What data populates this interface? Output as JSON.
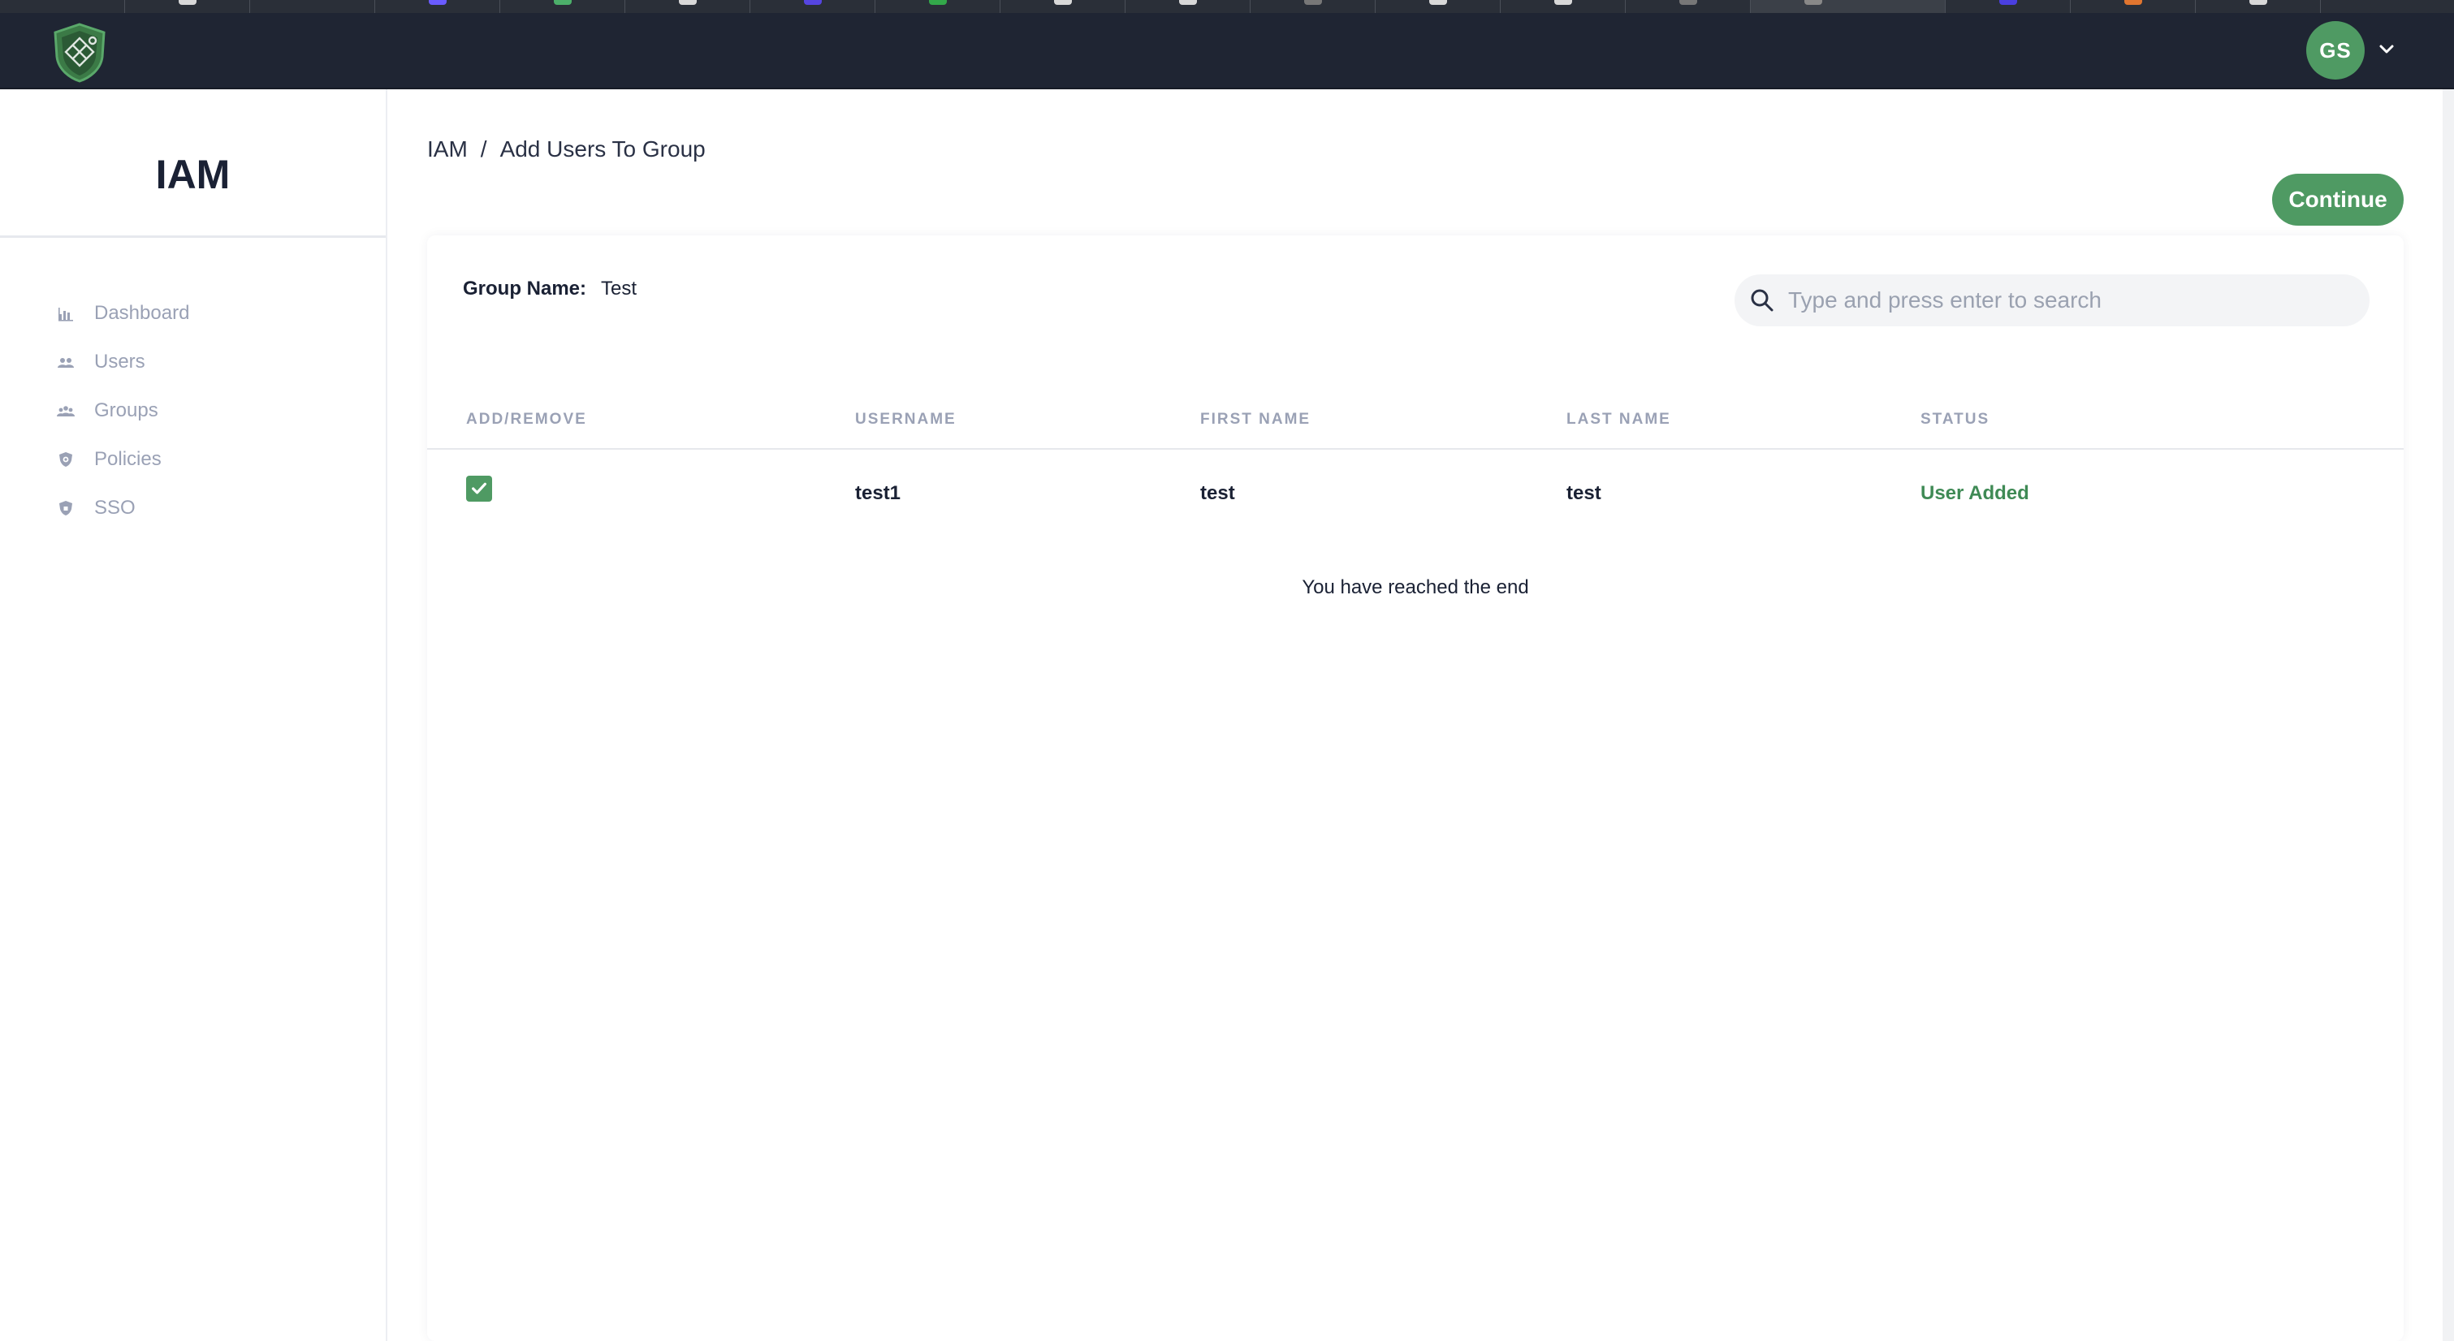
{
  "app": {
    "user_initials": "GS"
  },
  "sidebar": {
    "title": "IAM",
    "items": [
      {
        "label": "Dashboard",
        "icon": "bar-chart-icon"
      },
      {
        "label": "Users",
        "icon": "users-icon"
      },
      {
        "label": "Groups",
        "icon": "groups-icon"
      },
      {
        "label": "Policies",
        "icon": "shield-check-icon"
      },
      {
        "label": "SSO",
        "icon": "shield-icon"
      }
    ]
  },
  "breadcrumb": {
    "root": "IAM",
    "separator": "/",
    "current": "Add Users To Group"
  },
  "actions": {
    "continue_label": "Continue"
  },
  "group": {
    "label": "Group Name:",
    "value": "Test"
  },
  "search": {
    "placeholder": "Type and press enter to search",
    "value": ""
  },
  "table": {
    "columns": [
      "ADD/REMOVE",
      "USERNAME",
      "FIRST NAME",
      "LAST NAME",
      "STATUS"
    ],
    "rows": [
      {
        "checked": true,
        "username": "test1",
        "first_name": "test",
        "last_name": "test",
        "status": "User Added"
      }
    ],
    "end_message": "You have reached the end"
  },
  "colors": {
    "topbar": "#1f2533",
    "accent": "#4f9a63",
    "status_added": "#3f8a55",
    "muted": "#9aa1b5"
  }
}
